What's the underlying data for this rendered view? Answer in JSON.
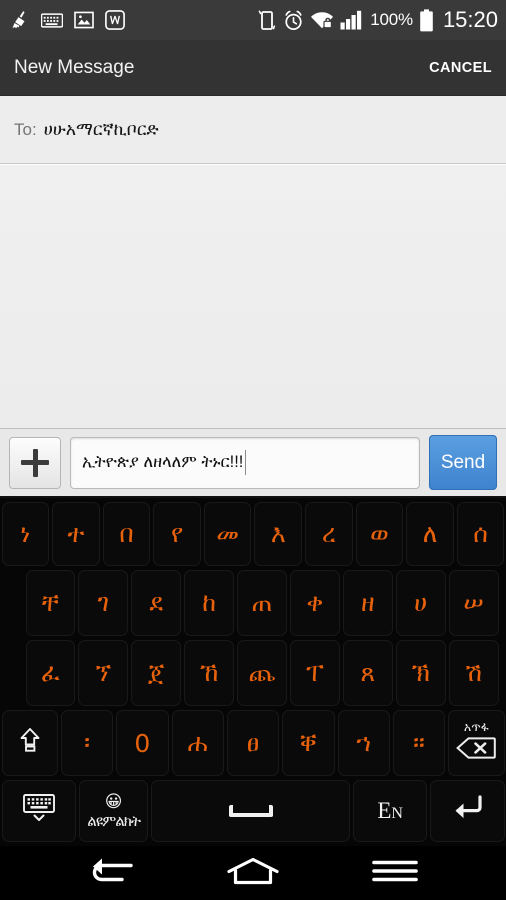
{
  "statusbar": {
    "left_icons": [
      "clean-broom-icon",
      "keyboard-icon",
      "image-icon",
      "wps-office-icon"
    ],
    "right_icons": [
      "vibrate-phone-icon",
      "alarm-clock-icon",
      "wifi-secure-icon",
      "signal-bars-icon"
    ],
    "battery_percent": "100%",
    "battery_icon": "battery-full-icon",
    "clock": "15:20"
  },
  "actionbar": {
    "title": "New Message",
    "cancel_label": "CANCEL"
  },
  "recipient": {
    "label": "To:",
    "value": "ሀሁአማርኛኪቦርድ"
  },
  "compose": {
    "add_label": "+",
    "message_value": "ኢትዮጵያ ለዘላለም ትኑር!!!",
    "message_placeholder": "",
    "send_label": "Send",
    "send_color": "#4a8fd6"
  },
  "keyboard": {
    "key_color": "#e8620c",
    "fn_key_color": "#f2f2f2",
    "background": "#060606",
    "row1": [
      "ነ",
      "ተ",
      "በ",
      "የ",
      "መ",
      "እ",
      "ረ",
      "ወ",
      "ለ",
      "ሰ"
    ],
    "row2": [
      "ቸ",
      "ገ",
      "ደ",
      "ከ",
      "ጠ",
      "ቀ",
      "ዘ",
      "ሀ",
      "ሠ"
    ],
    "row3": [
      "ፈ",
      "ኘ",
      "ጀ",
      "ኸ",
      "ጨ",
      "ፐ",
      "ጸ",
      "ኽ",
      "ሽ"
    ],
    "row4": {
      "shift": "shift-icon",
      "keys": [
        "፡",
        "0",
        "ሐ",
        "ፀ",
        "ቐ",
        "ኀ",
        "።"
      ],
      "delete_label": "አጥፋ",
      "delete_icon": "backspace-icon"
    },
    "row5": {
      "hide_keyboard": "hide-keyboard-icon",
      "emoji_icon": "😀",
      "emoji_sub": "ልዩምልክት",
      "space": "space-bar",
      "language_label": "En",
      "enter_icon": "enter-return-icon"
    }
  },
  "navbar": {
    "back": "back-icon",
    "home": "home-icon",
    "menu": "menu-icon"
  }
}
